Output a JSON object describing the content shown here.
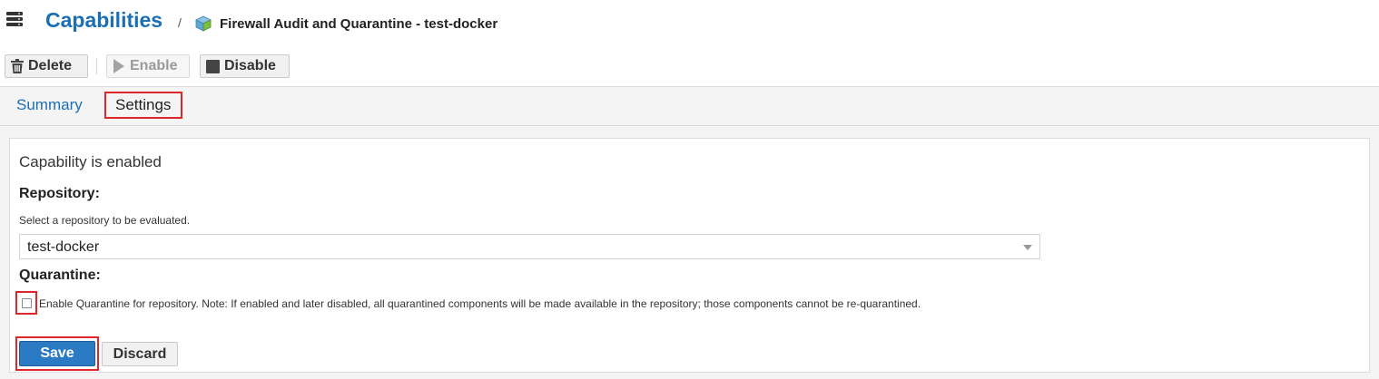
{
  "header": {
    "title": "Capabilities",
    "breadcrumb_separator": "/",
    "current": "Firewall Audit and Quarantine - test-docker"
  },
  "toolbar": {
    "delete_label": "Delete",
    "enable_label": "Enable",
    "disable_label": "Disable"
  },
  "tabs": [
    {
      "label": "Summary",
      "active": false
    },
    {
      "label": "Settings",
      "active": true
    }
  ],
  "settings": {
    "status": "Capability is enabled",
    "repository_label": "Repository:",
    "repository_help": "Select a repository to be evaluated.",
    "repository_value": "test-docker",
    "quarantine_label": "Quarantine:",
    "quarantine_checked": false,
    "quarantine_text": "Enable Quarantine for repository. Note: If enabled and later disabled, all quarantined components will be made available in the repository; those components cannot be re-quarantined.",
    "save_label": "Save",
    "discard_label": "Discard"
  },
  "colors": {
    "accent": "#1a6fb5",
    "primary_button": "#2b7bc4",
    "highlight": "#e0262b"
  },
  "icons": [
    "menu-icon",
    "cube-icon",
    "trash-icon",
    "play-icon",
    "stop-icon",
    "chevron-down-icon"
  ]
}
